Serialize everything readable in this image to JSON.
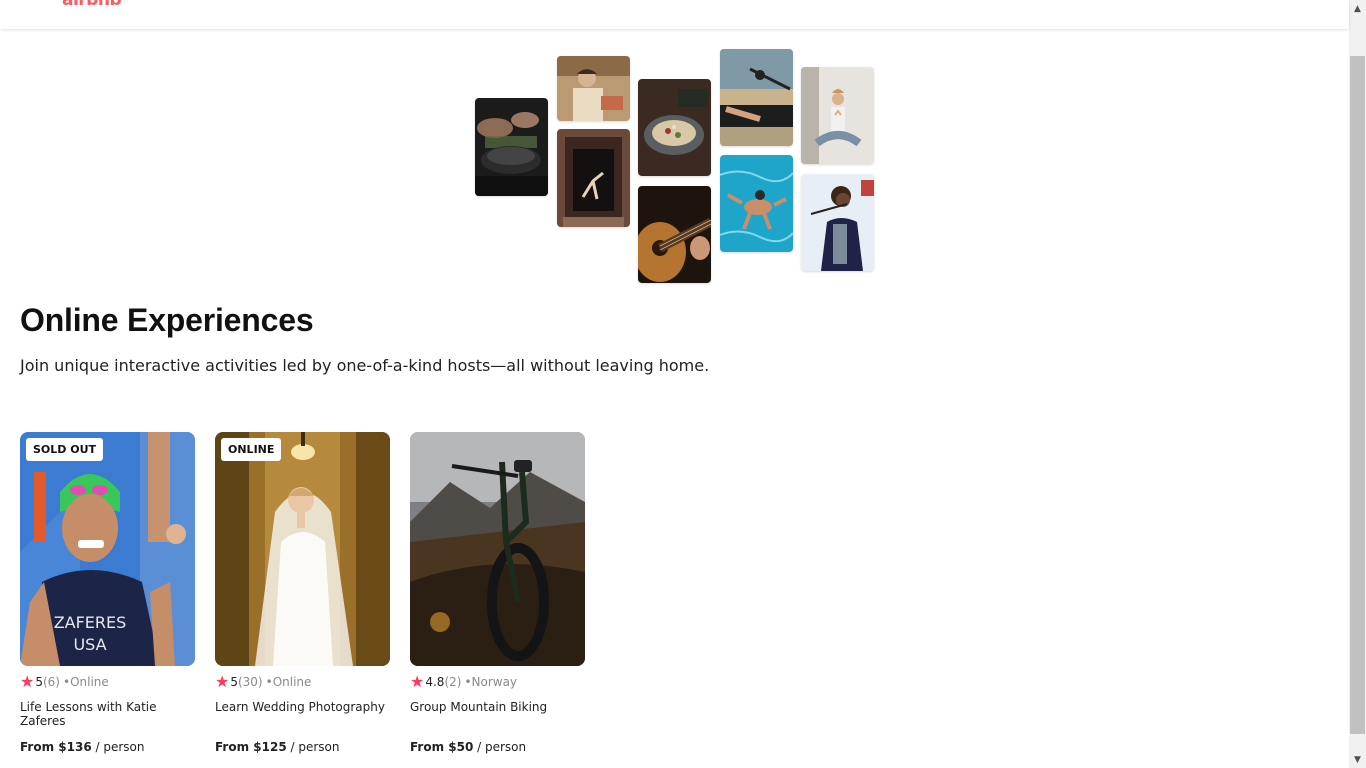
{
  "header": {
    "logo_text": "airbnb"
  },
  "hero": {
    "title": "Online Experiences",
    "subtitle": "Join unique interactive activities led by one-of-a-kind hosts—all without leaving home."
  },
  "collage": [
    {
      "name": "cooking-photo"
    },
    {
      "name": "baker-photo"
    },
    {
      "name": "dancer-photo"
    },
    {
      "name": "food-bowl-photo"
    },
    {
      "name": "guitar-photo"
    },
    {
      "name": "piano-singer-photo"
    },
    {
      "name": "swimmer-photo"
    },
    {
      "name": "yoga-photo"
    },
    {
      "name": "singer-photo"
    }
  ],
  "cards": [
    {
      "badge": "SOLD OUT",
      "rating": "5",
      "count": "(6)",
      "location": "•Online",
      "title": "Life Lessons with Katie Zaferes",
      "price": "From $136",
      "price_unit": " / person"
    },
    {
      "badge": "ONLINE",
      "rating": "5",
      "count": "(30)",
      "location": "•Online",
      "title": "Learn Wedding Photography",
      "price": "From $125",
      "price_unit": " / person"
    },
    {
      "badge": "",
      "rating": "4.8",
      "count": "(2)",
      "location": "•Norway",
      "title": "Group Mountain Biking",
      "price": "From $50",
      "price_unit": " / person"
    }
  ],
  "colors": {
    "brand": "#FF5A5F",
    "star": "#FF385C"
  },
  "scrollbar": {
    "up_arrow": "▲",
    "down_arrow": "▼"
  }
}
